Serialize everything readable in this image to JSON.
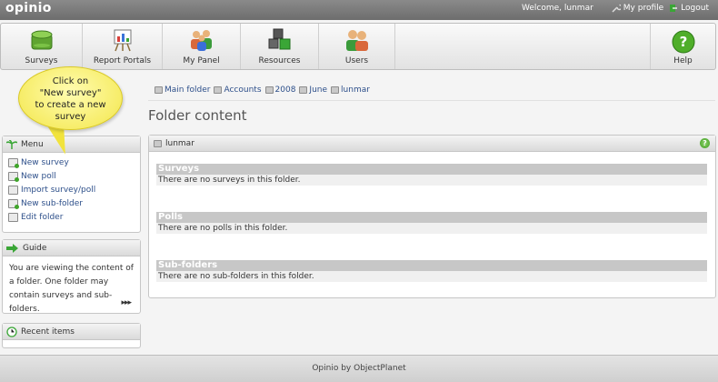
{
  "app": {
    "logo": "opinio"
  },
  "topbar": {
    "welcome": "Welcome, lunmar",
    "profile": "My profile",
    "logout": "Logout"
  },
  "nav": {
    "items": [
      {
        "label": "Surveys",
        "icon": "surveys-icon"
      },
      {
        "label": "Report Portals",
        "icon": "report-portals-icon"
      },
      {
        "label": "My Panel",
        "icon": "my-panel-icon"
      },
      {
        "label": "Resources",
        "icon": "resources-icon"
      },
      {
        "label": "Users",
        "icon": "users-icon"
      }
    ],
    "help": "Help"
  },
  "breadcrumb": [
    "Main folder",
    "Accounts",
    "2008",
    "June",
    "lunmar"
  ],
  "page_title": "Folder content",
  "tooltip": {
    "lines": [
      "Click on",
      "\"New survey\"",
      "to create a new",
      "survey"
    ]
  },
  "menu": {
    "title": "Menu",
    "items": [
      "New survey",
      "New poll",
      "Import survey/poll",
      "New sub-folder",
      "Edit folder"
    ]
  },
  "guide": {
    "title": "Guide",
    "text": "You are viewing the content of a folder. One folder may contain surveys and sub-folders.",
    "more": "▸▸▸"
  },
  "recent": {
    "title": "Recent items"
  },
  "panel": {
    "title": "lunmar",
    "sections": [
      {
        "heading": "Surveys",
        "message": "There are no surveys in this folder."
      },
      {
        "heading": "Polls",
        "message": "There are no polls in this folder."
      },
      {
        "heading": "Sub-folders",
        "message": "There are no sub-folders in this folder."
      }
    ]
  },
  "footer": {
    "text": "Opinio by ObjectPlanet"
  },
  "colors": {
    "topbar": "#6d6d6d",
    "link": "#2d4f8a",
    "tooltip": "#f3e64a",
    "section_head": "#c7c7c7"
  }
}
